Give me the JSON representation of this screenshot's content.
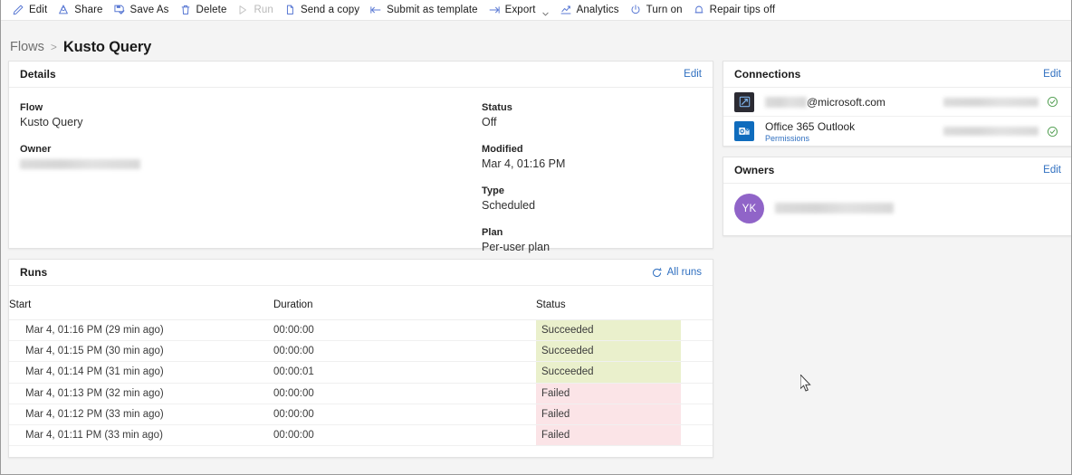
{
  "toolbar": {
    "items": [
      {
        "label": "Edit",
        "icon": "pencil-icon",
        "disabled": false,
        "caret": false
      },
      {
        "label": "Share",
        "icon": "share-icon",
        "disabled": false,
        "caret": false
      },
      {
        "label": "Save As",
        "icon": "save-as-icon",
        "disabled": false,
        "caret": false
      },
      {
        "label": "Delete",
        "icon": "trash-icon",
        "disabled": false,
        "caret": false
      },
      {
        "label": "Run",
        "icon": "play-icon",
        "disabled": true,
        "caret": false
      },
      {
        "label": "Send a copy",
        "icon": "copy-icon",
        "disabled": false,
        "caret": false
      },
      {
        "label": "Submit as template",
        "icon": "submit-icon",
        "disabled": false,
        "caret": false
      },
      {
        "label": "Export",
        "icon": "export-icon",
        "disabled": false,
        "caret": true
      },
      {
        "label": "Analytics",
        "icon": "analytics-icon",
        "disabled": false,
        "caret": false
      },
      {
        "label": "Turn on",
        "icon": "power-icon",
        "disabled": false,
        "caret": false
      },
      {
        "label": "Repair tips off",
        "icon": "bell-icon",
        "disabled": false,
        "caret": false
      }
    ]
  },
  "breadcrumb": {
    "root": "Flows",
    "separator": ">",
    "current": "Kusto Query"
  },
  "details": {
    "title": "Details",
    "edit_label": "Edit",
    "left_fields": [
      {
        "label": "Flow",
        "value": "Kusto Query"
      },
      {
        "label": "Owner",
        "value": "",
        "redacted": true,
        "redacted_width": 133
      }
    ],
    "right_fields": [
      {
        "label": "Status",
        "value": "Off"
      },
      {
        "label": "Modified",
        "value": "Mar 4, 01:16 PM"
      },
      {
        "label": "Type",
        "value": "Scheduled"
      },
      {
        "label": "Plan",
        "value": "Per-user plan"
      }
    ]
  },
  "connections": {
    "title": "Connections",
    "edit_label": "Edit",
    "rows": [
      {
        "icon": "azure-data-explorer-icon",
        "name_prefix_redacted": true,
        "name_prefix_width": 46,
        "name": "@microsoft.com",
        "sub_label": "",
        "detail_redacted": true,
        "detail_width": 105,
        "status": "connected",
        "status_color": "#4a9a4a"
      },
      {
        "icon": "office-365-outlook-icon",
        "name_prefix_redacted": false,
        "name_prefix_width": 0,
        "name": "Office 365 Outlook",
        "sub_label": "Permissions",
        "detail_redacted": true,
        "detail_width": 105,
        "status": "connected",
        "status_color": "#4a9a4a"
      }
    ]
  },
  "owners": {
    "title": "Owners",
    "edit_label": "Edit",
    "rows": [
      {
        "initials": "YK",
        "avatar_color": "#9064c8",
        "name": "",
        "redacted": true,
        "redacted_width": 131
      }
    ]
  },
  "runs": {
    "title": "Runs",
    "all_runs_label": "All runs",
    "refresh_icon": "refresh-icon",
    "columns": [
      "Start",
      "Duration",
      "Status"
    ],
    "rows": [
      {
        "start": "Mar 4, 01:16 PM (29 min ago)",
        "duration": "00:00:00",
        "status": "Succeeded"
      },
      {
        "start": "Mar 4, 01:15 PM (30 min ago)",
        "duration": "00:00:00",
        "status": "Succeeded"
      },
      {
        "start": "Mar 4, 01:14 PM (31 min ago)",
        "duration": "00:00:01",
        "status": "Succeeded"
      },
      {
        "start": "Mar 4, 01:13 PM (32 min ago)",
        "duration": "00:00:00",
        "status": "Failed"
      },
      {
        "start": "Mar 4, 01:12 PM (33 min ago)",
        "duration": "00:00:00",
        "status": "Failed"
      },
      {
        "start": "Mar 4, 01:11 PM (33 min ago)",
        "duration": "00:00:00",
        "status": "Failed"
      }
    ]
  },
  "colors": {
    "accent_link": "#2f6fc0",
    "icon_blue": "#5b7ad4",
    "status_succeeded_bg": "#eaf0cc",
    "status_failed_bg": "#fbe4e7",
    "avatar_purple": "#9064c8",
    "page_bg": "#f4f4f4"
  }
}
